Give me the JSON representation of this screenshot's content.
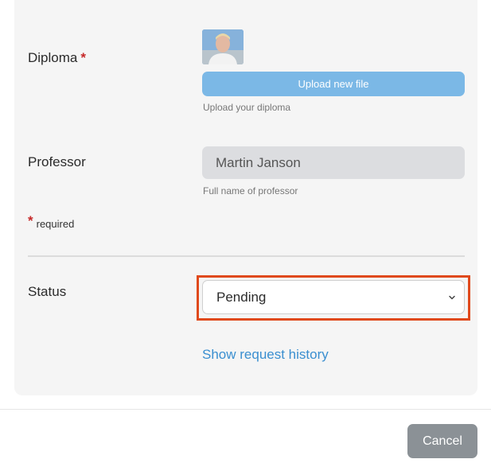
{
  "form": {
    "diploma": {
      "label": "Diploma",
      "required_mark": "*",
      "upload_label": "Upload new file",
      "help": "Upload your diploma",
      "thumbnail_icon": "avatar-photo"
    },
    "professor": {
      "label": "Professor",
      "value": "Martin Janson",
      "help": "Full name of professor"
    },
    "required_note": {
      "mark": "*",
      "text": "required"
    },
    "status": {
      "label": "Status",
      "selected": "Pending",
      "chevron_icon": "chevron-down-icon"
    },
    "history_link": "Show request history"
  },
  "footer": {
    "cancel_label": "Cancel"
  },
  "colors": {
    "accent_link": "#3a8fd0",
    "upload_button": "#7bb8e6",
    "highlight_border": "#e0491c",
    "required_mark": "#c62828",
    "cancel_button": "#8b9196"
  }
}
